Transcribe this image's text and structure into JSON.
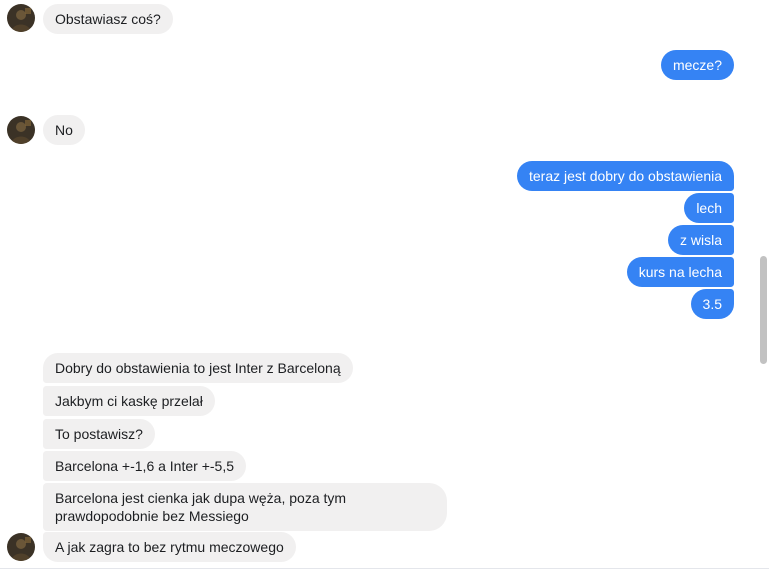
{
  "messages": [
    {
      "text": "Obstawiasz coś?"
    },
    {
      "text": "mecze?"
    },
    {
      "text": "No"
    },
    {
      "text": "teraz jest dobry do obstawienia"
    },
    {
      "text": "lech"
    },
    {
      "text": "z wisla"
    },
    {
      "text": "kurs na lecha"
    },
    {
      "text": "3.5"
    },
    {
      "text": "Dobry do obstawienia to jest Inter z Barceloną"
    },
    {
      "text": "Jakbym ci kaskę przelał"
    },
    {
      "text": "To postawisz?"
    },
    {
      "text": "Barcelona +-1,6 a Inter +-5,5"
    },
    {
      "text": "Barcelona jest cienka jak dupa węża, poza tym prawdopodobnie bez Messiego"
    },
    {
      "text": "A jak zagra to bez rytmu meczowego"
    }
  ],
  "colors": {
    "outgoing_bubble": "#3583f4",
    "incoming_bubble": "#f1f0f0"
  },
  "icons": {
    "avatar": "contact-avatar-icon"
  }
}
